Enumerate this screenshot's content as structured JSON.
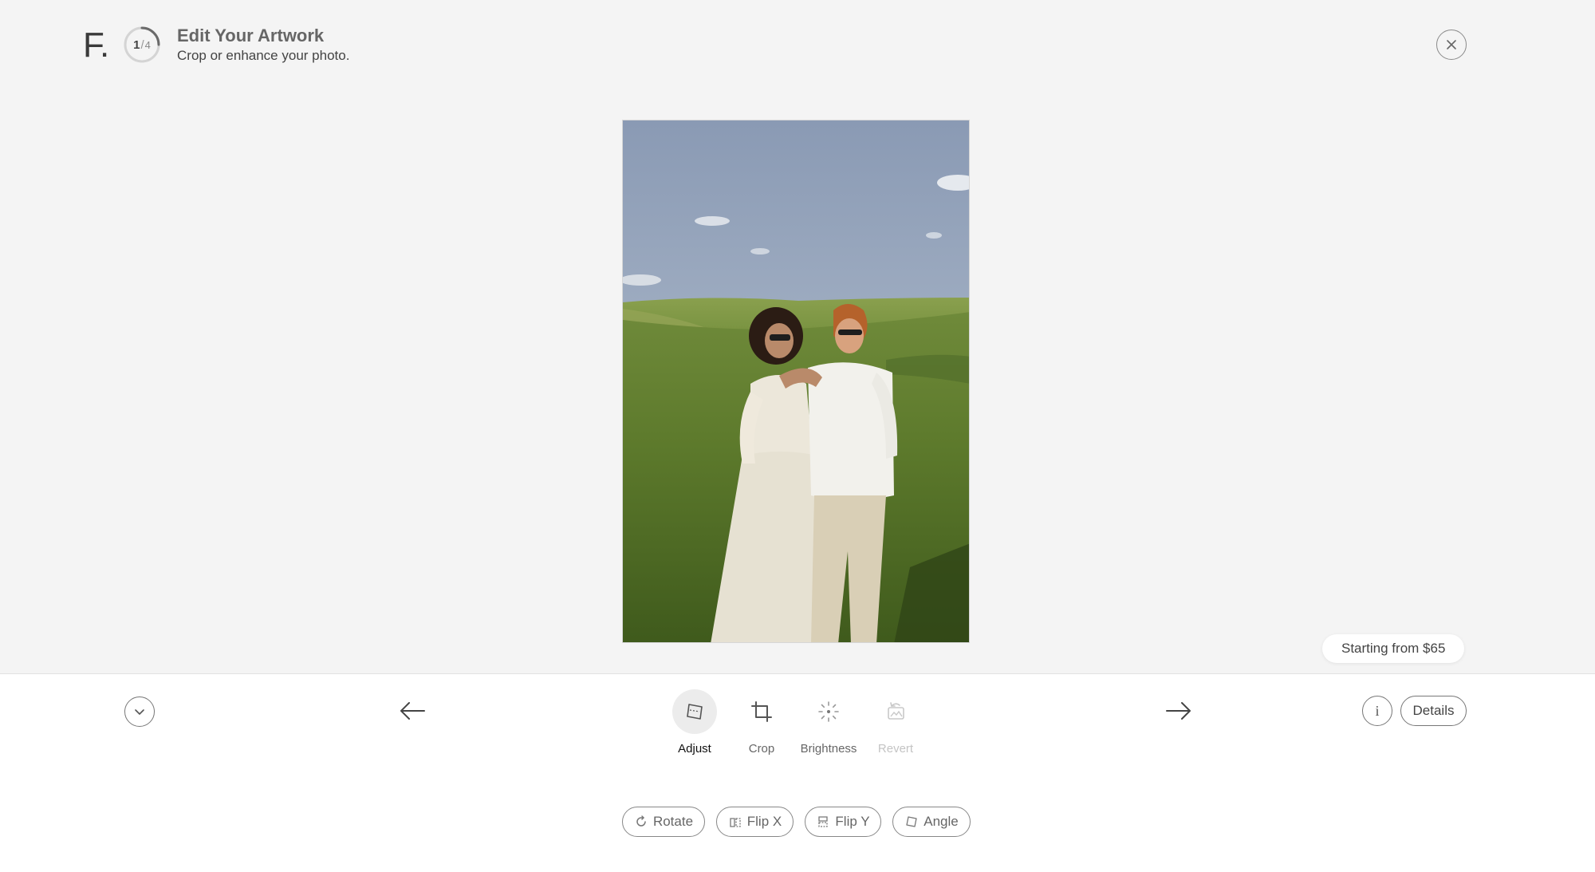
{
  "header": {
    "logo": "F.",
    "step_current": "1",
    "step_separator": "/",
    "step_total": "4",
    "title": "Edit Your Artwork",
    "subtitle": "Crop or enhance your photo."
  },
  "artwork": {
    "icon": "photo-couple-meadow",
    "progress_fraction": 0.25
  },
  "price": {
    "label": "Starting from $65"
  },
  "toolbar": {
    "tools": [
      {
        "label": "Adjust",
        "icon": "adjust-icon",
        "state": "active"
      },
      {
        "label": "Crop",
        "icon": "crop-icon",
        "state": "normal"
      },
      {
        "label": "Brightness",
        "icon": "brightness-icon",
        "state": "normal"
      },
      {
        "label": "Revert",
        "icon": "revert-icon",
        "state": "disabled"
      }
    ],
    "info_icon": "i",
    "details_label": "Details"
  },
  "actions": [
    {
      "label": "Rotate",
      "icon": "rotate-icon"
    },
    {
      "label": "Flip X",
      "icon": "flip-x-icon"
    },
    {
      "label": "Flip Y",
      "icon": "flip-y-icon"
    },
    {
      "label": "Angle",
      "icon": "angle-icon"
    }
  ],
  "colors": {
    "background": "#f4f4f4",
    "toolbar_background": "#ffffff",
    "text_primary": "#333333",
    "disabled": "#c4c4c4"
  }
}
